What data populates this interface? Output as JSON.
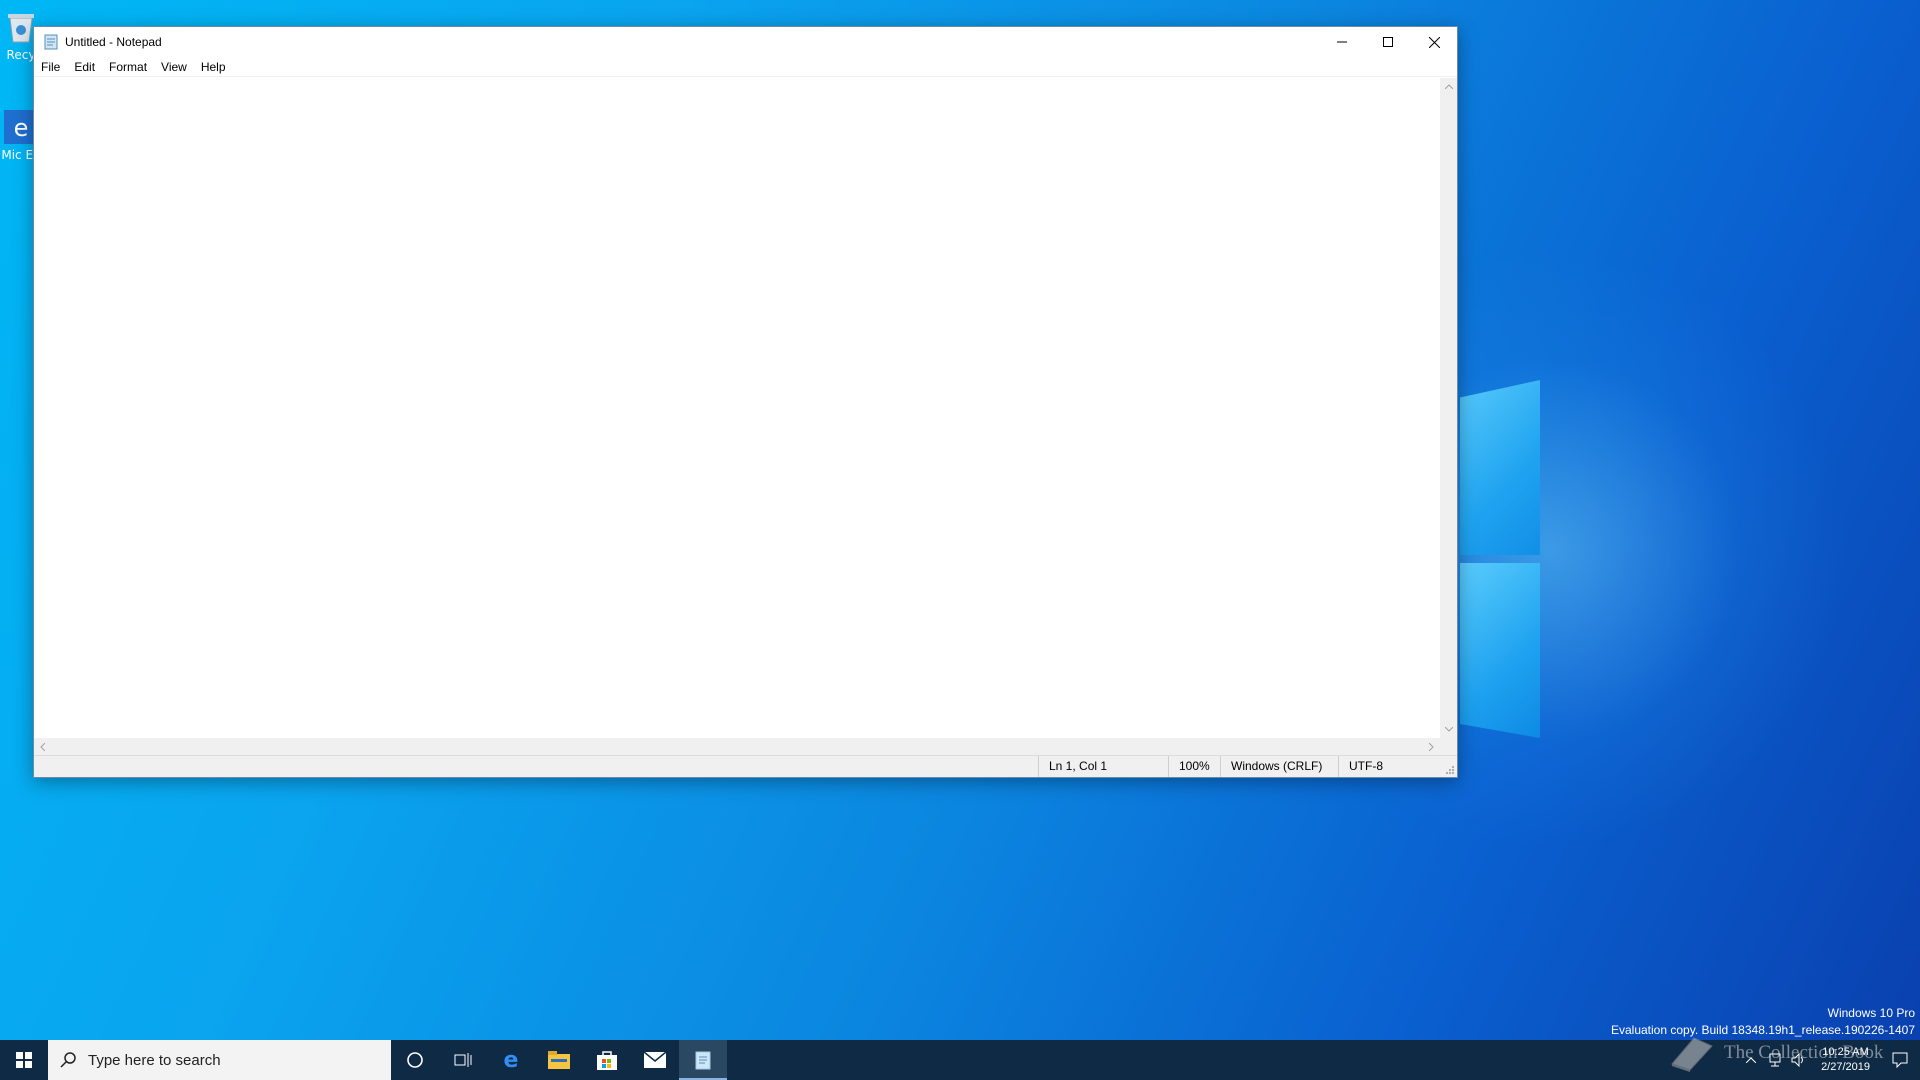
{
  "desktop": {
    "icons": [
      {
        "label": "Recy",
        "icon": "recycle-bin-icon"
      },
      {
        "label": "Mic Ed",
        "icon": "edge-shortcut-icon"
      }
    ],
    "edition": "Windows 10 Pro",
    "build": "Evaluation copy. Build 18348.19h1_release.190226-1407",
    "collection_watermark": "The Collection Book"
  },
  "notepad": {
    "title": "Untitled - Notepad",
    "menu": [
      "File",
      "Edit",
      "Format",
      "View",
      "Help"
    ],
    "content": "",
    "status": {
      "position": "Ln 1, Col 1",
      "zoom": "100%",
      "line_ending": "Windows (CRLF)",
      "encoding": "UTF-8"
    }
  },
  "taskbar": {
    "search_placeholder": "Type here to search",
    "apps": [
      "cortana-icon",
      "task-view-icon",
      "edge-icon",
      "file-explorer-icon",
      "store-icon",
      "mail-icon",
      "notepad-icon"
    ],
    "clock": {
      "time": "10:25 AM",
      "date": "2/27/2019"
    }
  },
  "colors": {
    "taskbar": "#0f2a45",
    "desktop_accent": "#0a86e0"
  }
}
